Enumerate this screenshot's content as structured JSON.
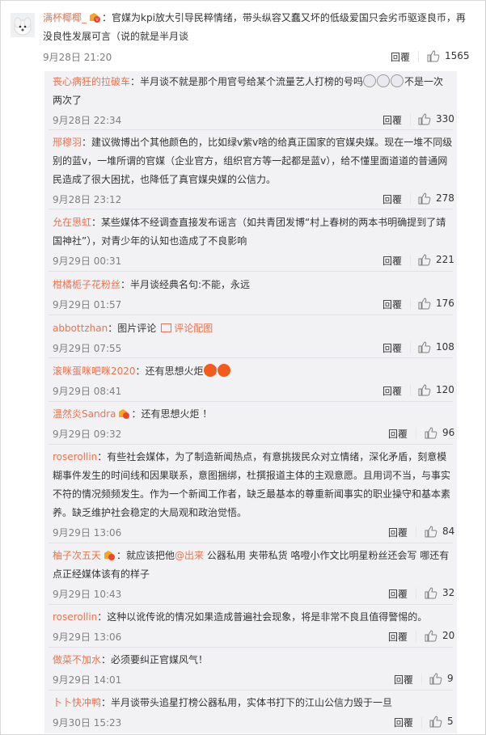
{
  "top": {
    "user": "满杯椰椰_",
    "text": "：官媒为kpi放大引导民粹情绪，带头纵容又蠢又坏的低级爱国只会劣币驱逐良币，再没良性发展可言（说的就是半月谈",
    "time": "9月28日 21:20",
    "reply": "回覆",
    "likes": "1565"
  },
  "replies": [
    {
      "user": "丧心病狂的拉破车",
      "text": "：半月谈不就是那个用官号给某个流量艺人打榜的号吗",
      "text2": "不是一次两次了",
      "time": "9月28日 22:34",
      "reply": "回覆",
      "likes": "330"
    },
    {
      "user": "邢穆羽",
      "text": "：建议微博出个其他颜色的，比如绿v紫v啥的给真正国家的官媒央媒。现在一堆不同级别的蓝v，一堆所谓的官媒（企业官方，组织官方等一起都是蓝v），给不懂里面道道的普通网民造成了很大困扰，也降低了真官媒央媒的公信力。",
      "time": "9月28日 23:12",
      "reply": "回覆",
      "likes": "278"
    },
    {
      "user": "允在思虹",
      "text": "：某些媒体不经调查直接发布谣言（如共青团发博“村上春树的两本书明确提到了靖国神社”），对青少年的认知也造成了不良影响",
      "time": "9月29日 00:31",
      "reply": "回覆",
      "likes": "221"
    },
    {
      "user": "柑橘栀子花粉丝",
      "text": "：半月谈经典名句:不能，永远",
      "time": "9月29日 01:57",
      "reply": "回覆",
      "likes": "176"
    },
    {
      "user": "abbottzhan",
      "text": "：图片评论",
      "link": "评论配图",
      "time": "9月29日 07:55",
      "reply": "回覆",
      "likes": "108"
    },
    {
      "user": "滚咪蛋咪吧咪2020",
      "text": "：还有思想火炬",
      "time": "9月29日 08:41",
      "reply": "回覆",
      "likes": "120"
    },
    {
      "user": "温然炎Sandra",
      "text": "：还有思想火炬 ！",
      "time": "9月29日 09:32",
      "reply": "回覆",
      "likes": "96"
    },
    {
      "user": "roserollin",
      "text": "：有些社会媒体，为了制造新闻热点，有意挑拨民众对立情绪，深化矛盾，刻意模糊事件发生的时间线和因果联系，意图捆绑，杜撰报道主体的主观意愿。且用词不当，与事实不符的情况频频发生。作为一个新闻工作者，缺乏最基本的尊重新闻事实的职业操守和基本素养。缺乏维护社会稳定的大局观和政治觉悟。",
      "time": "9月29日 13:06",
      "reply": "回覆",
      "likes": "84"
    },
    {
      "user": "柚子次五天",
      "text": "：就应该把他",
      "mention": "@出来",
      "text2": " 公器私用 夹带私货 咯噔小作文比明星粉丝还会写 哪还有点正经媒体该有的样子",
      "time": "9月29日 10:43",
      "reply": "回覆",
      "likes": "32"
    },
    {
      "user": "roserollin",
      "text": "：这种以讹传讹的情况如果造成普遍社会现象，将是非常不良且值得警惕的。",
      "time": "9月29日 13:06",
      "reply": "回覆",
      "likes": "20"
    },
    {
      "user": "做菜不加水",
      "text": "：必须要纠正官媒风气！",
      "time": "9月29日 14:01",
      "reply": "回覆",
      "likes": "9"
    },
    {
      "user": "卜卜快冲鸭",
      "text": "：半月谈带头追星打榜公器私用，实体书打下的江山公信力毁于一旦",
      "time": "9月30日 15:23",
      "reply": "回覆",
      "likes": "5"
    }
  ]
}
